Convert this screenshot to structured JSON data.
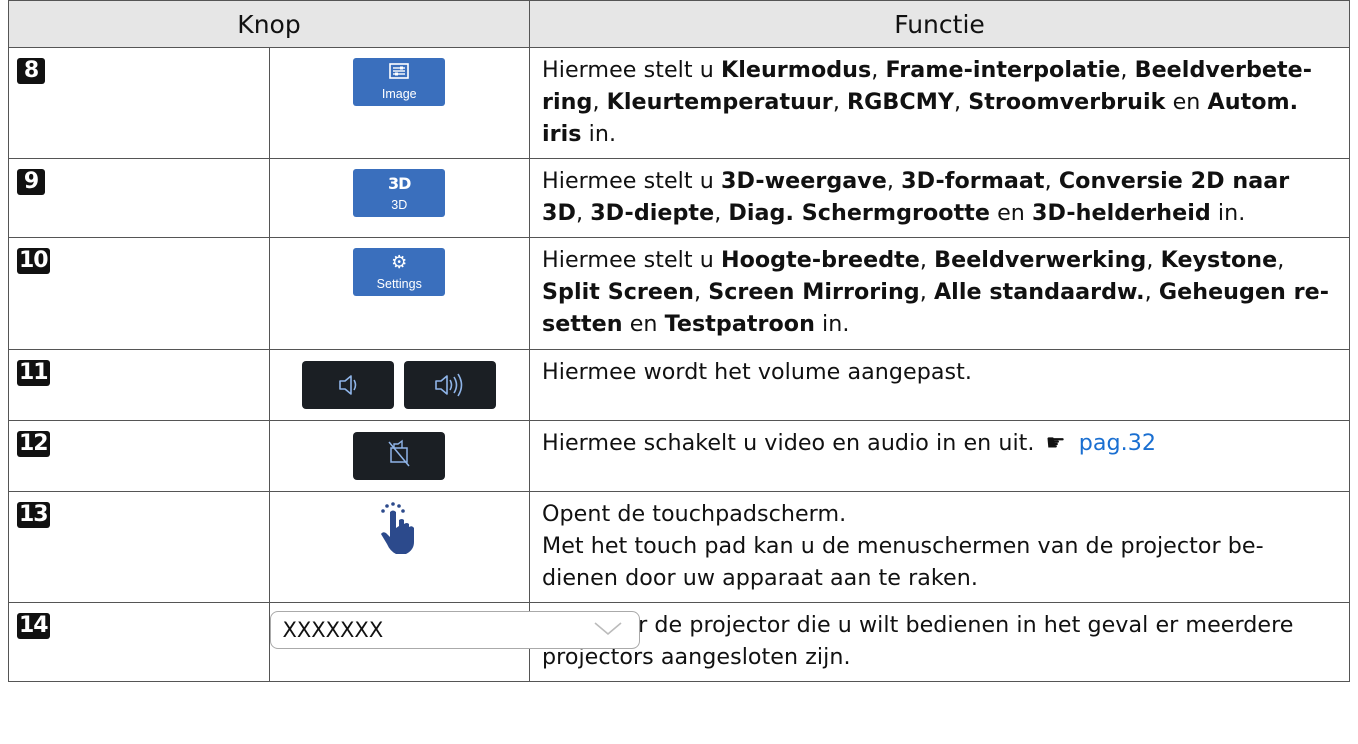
{
  "header": {
    "col_button": "Knop",
    "col_function": "Functie"
  },
  "rows": [
    {
      "num": "8",
      "button_label": "Image"
    },
    {
      "num": "9",
      "button_label": "3D"
    },
    {
      "num": "10",
      "button_label": "Settings"
    },
    {
      "num": "11",
      "desc": "Hiermee wordt het volume aangepast."
    },
    {
      "num": "12",
      "desc": "Hiermee schakelt u video en audio in en uit.",
      "link": "pag.32"
    },
    {
      "num": "13",
      "desc_line1": "Opent de touchpadscherm.",
      "desc_line2": "Met het touch pad kan u de menuschermen van de projector be-",
      "desc_line3": "dienen door uw apparaat aan te raken."
    },
    {
      "num": "14",
      "select_value": "XXXXXXX",
      "desc_line1": "Selecteer de projector die u wilt bedienen in het geval er meerdere",
      "desc_line2": "projectors aangesloten zijn."
    }
  ],
  "row8_text": {
    "t1": "Hiermee stelt u ",
    "b1": "Kleurmodus",
    "t2": ", ",
    "b2": "Frame-interpolatie",
    "t3": ", ",
    "b3": "Beeldverbete-",
    "b4": "ring",
    "t4": ", ",
    "b5": "Kleurtemperatuur",
    "t5": ", ",
    "b6": "RGBCMY",
    "t6": ", ",
    "b7": "Stroomverbruik",
    "t7": " en ",
    "b8": "Autom.",
    "b9": "iris",
    "t8": " in."
  },
  "row9_text": {
    "t1": "Hiermee stelt u ",
    "b1": "3D-weergave",
    "t2": ", ",
    "b2": "3D-formaat",
    "t3": ", ",
    "b3": "Conversie 2D naar",
    "b4": "3D",
    "t4": ", ",
    "b5": "3D-diepte",
    "t5": ", ",
    "b6": "Diag. Schermgrootte",
    "t6": " en ",
    "b7": "3D-helderheid",
    "t7": " in."
  },
  "row10_text": {
    "t1": "Hiermee stelt u ",
    "b1": "Hoogte-breedte",
    "t2": ", ",
    "b2": "Beeldverwerking",
    "t3": ", ",
    "b3": "Keystone",
    "t4": ",",
    "b4": "Split Screen",
    "t5": ", ",
    "b5": "Screen Mirroring",
    "t6": ", ",
    "b6": "Alle standaardw.",
    "t7": ", ",
    "b7": "Geheugen re-",
    "b8": "setten",
    "t8": " en ",
    "b9": "Testpatroon",
    "t9": " in."
  },
  "icons": {
    "pointer": "☛"
  }
}
